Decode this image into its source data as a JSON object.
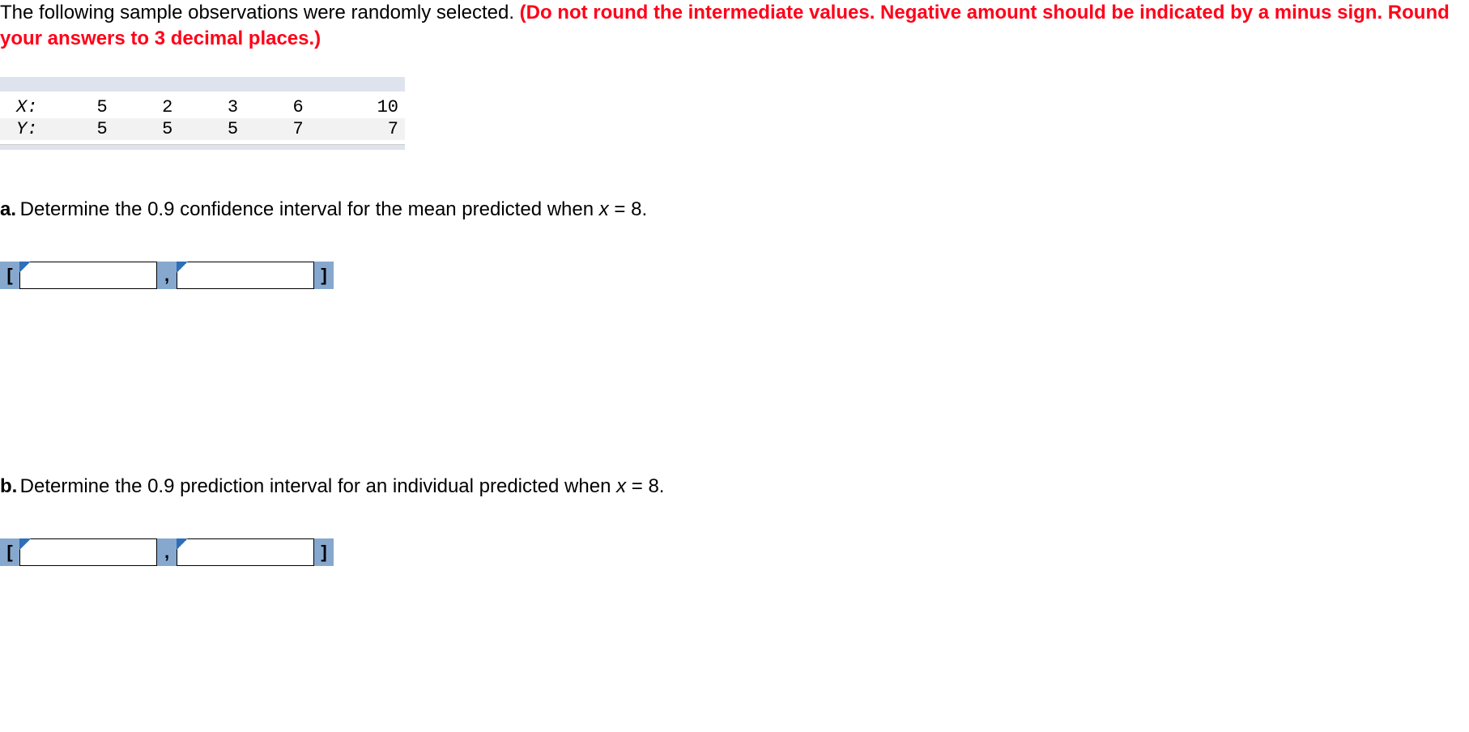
{
  "intro": {
    "lead": "The following sample observations were randomly selected. ",
    "warning": "(Do not round the intermediate values. Negative amount should be indicated by a minus sign. Round your answers to 3 decimal places.)"
  },
  "table": {
    "row_x_label": "X:",
    "row_y_label": "Y:",
    "x": [
      "5",
      "2",
      "3",
      "6",
      "10"
    ],
    "y": [
      "5",
      "5",
      "5",
      "7",
      "7"
    ]
  },
  "part_a": {
    "label": "a.",
    "text_before": "Determine the 0.9 confidence interval for the mean predicted when ",
    "var": "x",
    "eq": " = 8."
  },
  "part_b": {
    "label": "b.",
    "text_before": "Determine the 0.9 prediction interval for an individual predicted when ",
    "var": "x",
    "eq": " = 8."
  },
  "brackets": {
    "open": "[",
    "comma": ",",
    "close": "]"
  },
  "inputs": {
    "a_low": "",
    "a_high": "",
    "b_low": "",
    "b_high": ""
  }
}
